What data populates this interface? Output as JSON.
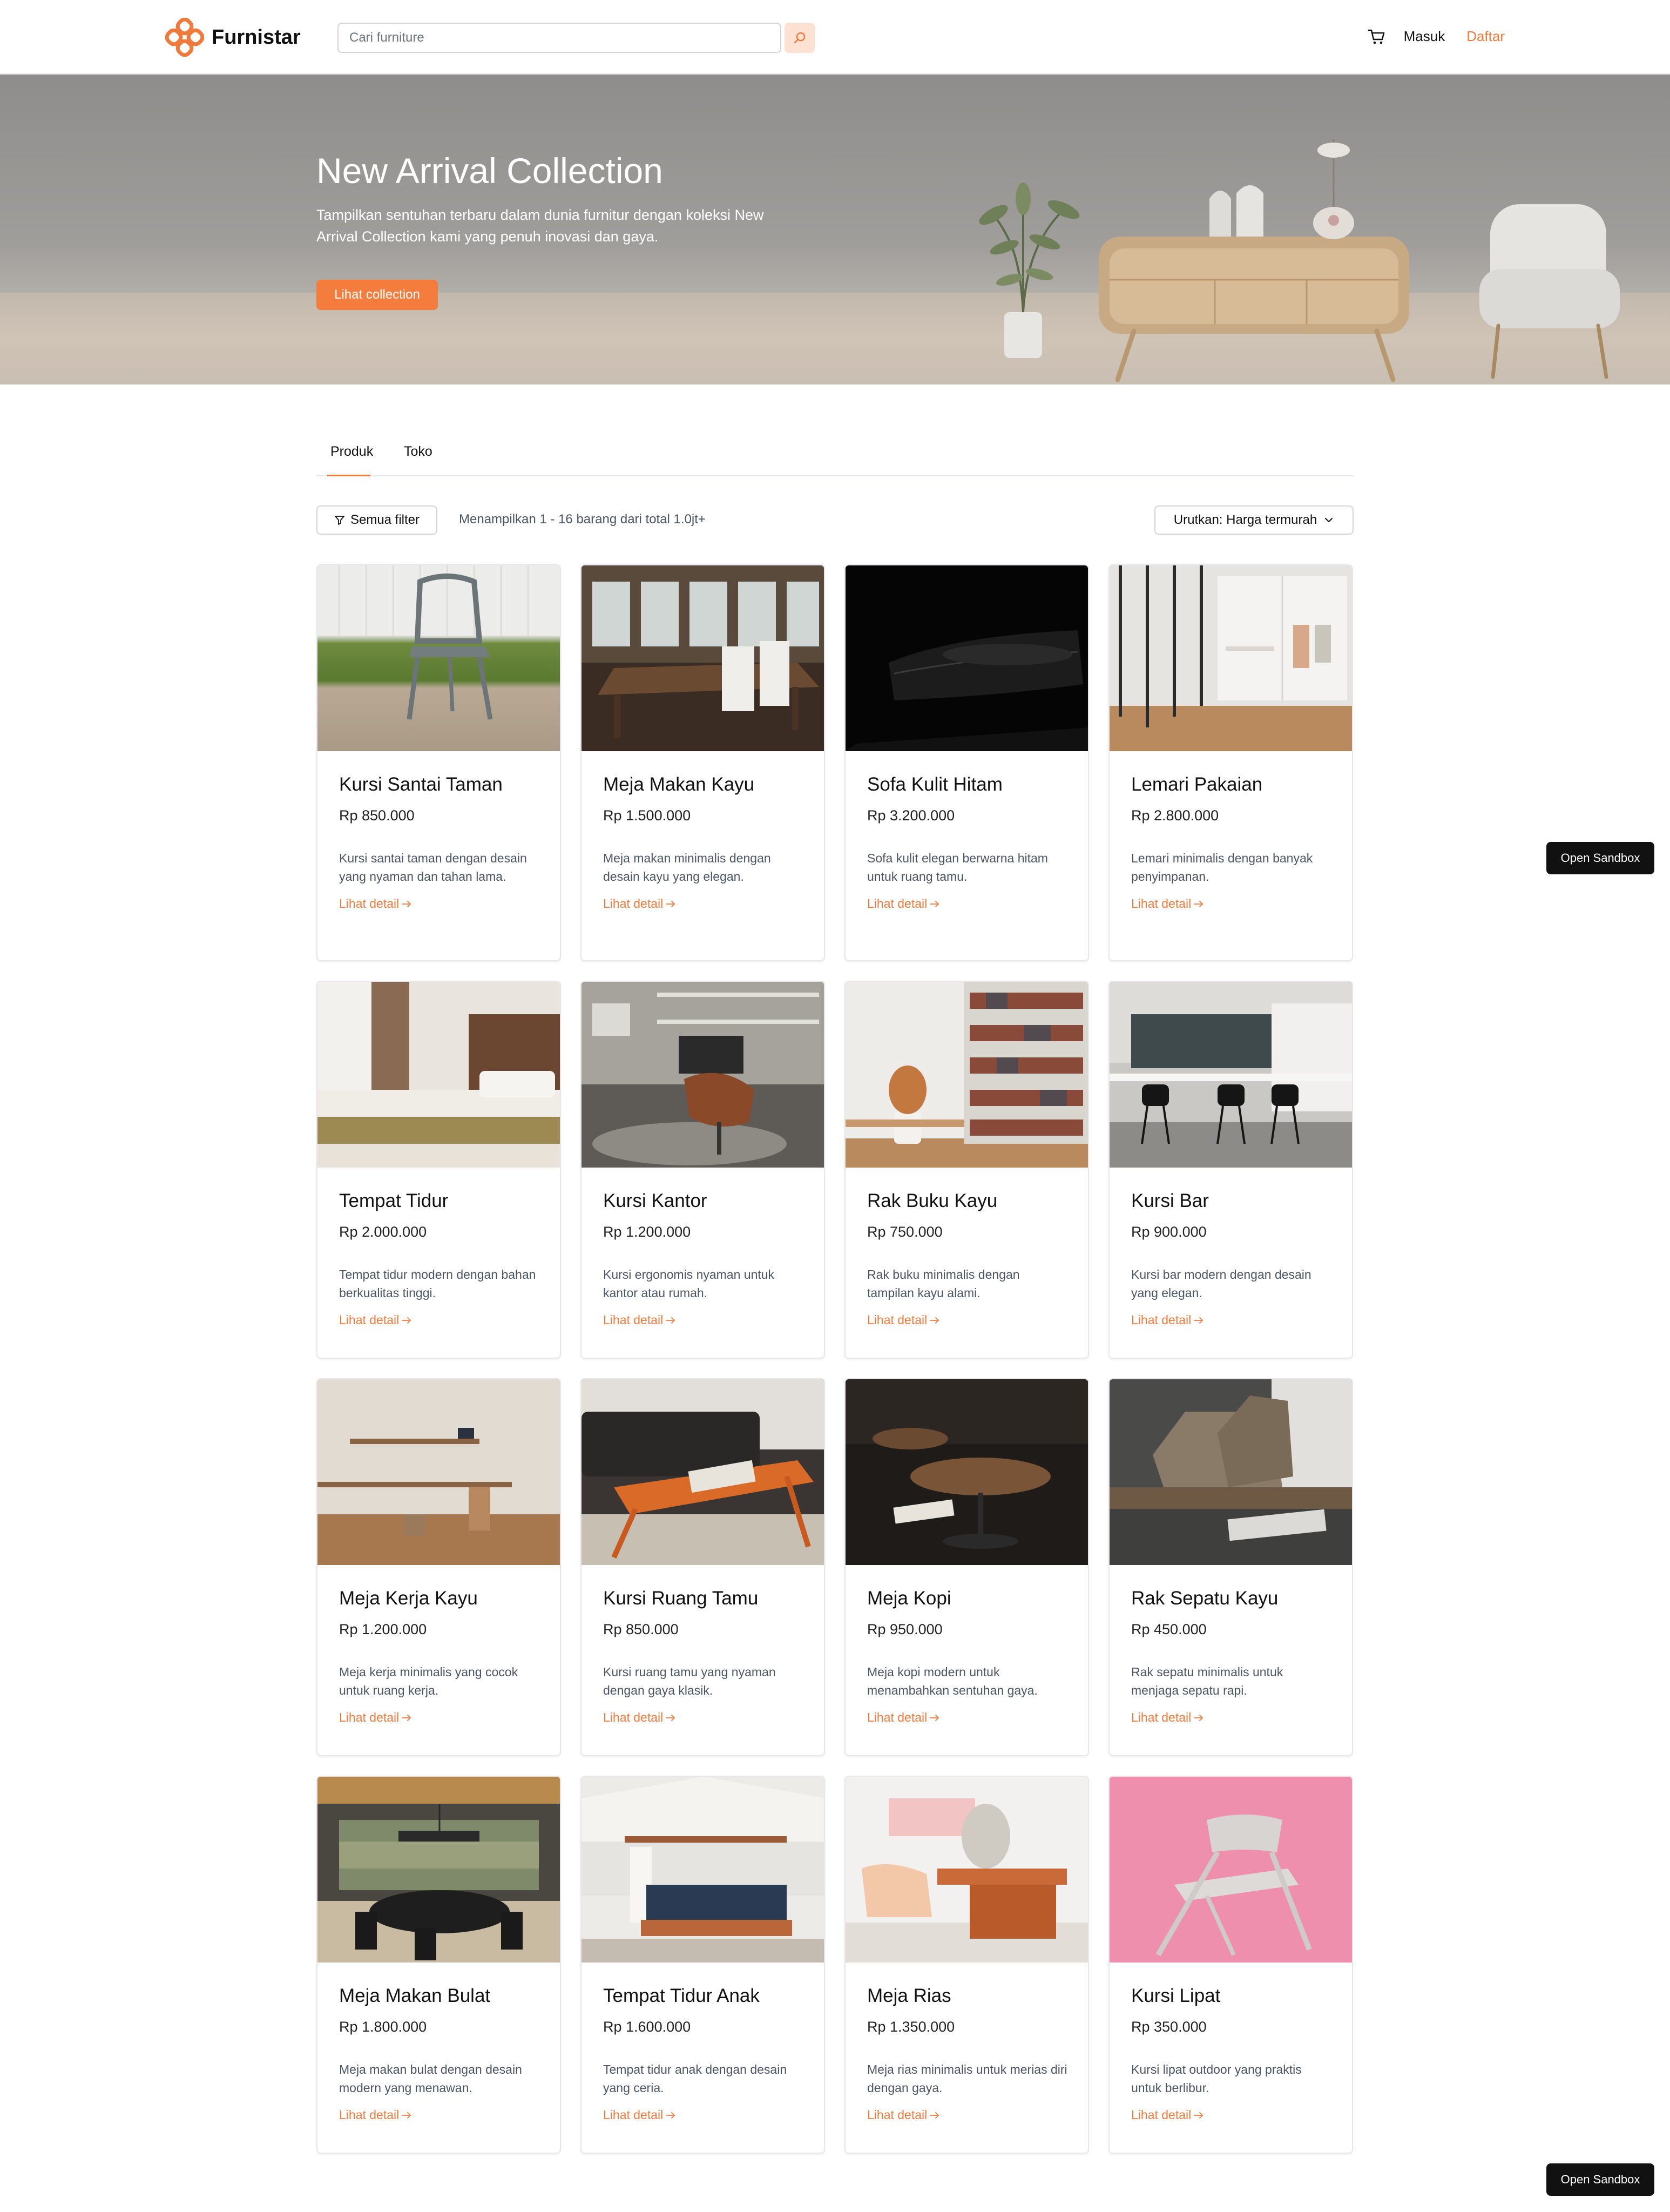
{
  "brand": {
    "name": "Furnistar",
    "accent": "#f07a3b"
  },
  "search": {
    "placeholder": "Cari furniture",
    "icon": "search-icon"
  },
  "nav": {
    "cart_icon": "cart-icon",
    "login": "Masuk",
    "register": "Daftar"
  },
  "hero": {
    "title": "New Arrival Collection",
    "subtitle": "Tampilkan sentuhan terbaru dalam dunia furnitur dengan koleksi New Arrival Collection kami yang penuh inovasi dan gaya.",
    "cta": "Lihat collection"
  },
  "tabs": [
    {
      "label": "Produk",
      "active": true
    },
    {
      "label": "Toko",
      "active": false
    }
  ],
  "toolbar": {
    "filter_label": "Semua filter",
    "filter_icon": "filter-icon",
    "results": "Menampilkan 1 - 16 barang dari total 1.0jt+",
    "sort_label": "Urutkan: Harga termurah",
    "sort_icon": "chevron-down-icon"
  },
  "products": [
    {
      "name": "Kursi Santai Taman",
      "price": "Rp 850.000",
      "desc": "Kursi santai taman dengan desain yang nyaman dan tahan lama.",
      "link": "Lihat detail"
    },
    {
      "name": "Meja Makan Kayu",
      "price": "Rp 1.500.000",
      "desc": "Meja makan minimalis dengan desain kayu yang elegan.",
      "link": "Lihat detail"
    },
    {
      "name": "Sofa Kulit Hitam",
      "price": "Rp 3.200.000",
      "desc": "Sofa kulit elegan berwarna hitam untuk ruang tamu.",
      "link": "Lihat detail"
    },
    {
      "name": "Lemari Pakaian",
      "price": "Rp 2.800.000",
      "desc": "Lemari minimalis dengan banyak penyimpanan.",
      "link": "Lihat detail"
    },
    {
      "name": "Tempat Tidur",
      "price": "Rp 2.000.000",
      "desc": "Tempat tidur modern dengan bahan berkualitas tinggi.",
      "link": "Lihat detail"
    },
    {
      "name": "Kursi Kantor",
      "price": "Rp 1.200.000",
      "desc": "Kursi ergonomis nyaman untuk kantor atau rumah.",
      "link": "Lihat detail"
    },
    {
      "name": "Rak Buku Kayu",
      "price": "Rp 750.000",
      "desc": "Rak buku minimalis dengan tampilan kayu alami.",
      "link": "Lihat detail"
    },
    {
      "name": "Kursi Bar",
      "price": "Rp 900.000",
      "desc": "Kursi bar modern dengan desain yang elegan.",
      "link": "Lihat detail"
    },
    {
      "name": "Meja Kerja Kayu",
      "price": "Rp 1.200.000",
      "desc": "Meja kerja minimalis yang cocok untuk ruang kerja.",
      "link": "Lihat detail"
    },
    {
      "name": "Kursi Ruang Tamu",
      "price": "Rp 850.000",
      "desc": "Kursi ruang tamu yang nyaman dengan gaya klasik.",
      "link": "Lihat detail"
    },
    {
      "name": "Meja Kopi",
      "price": "Rp 950.000",
      "desc": "Meja kopi modern untuk menambahkan sentuhan gaya.",
      "link": "Lihat detail"
    },
    {
      "name": "Rak Sepatu Kayu",
      "price": "Rp 450.000",
      "desc": "Rak sepatu minimalis untuk menjaga sepatu rapi.",
      "link": "Lihat detail"
    },
    {
      "name": "Meja Makan Bulat",
      "price": "Rp 1.800.000",
      "desc": "Meja makan bulat dengan desain modern yang menawan.",
      "link": "Lihat detail"
    },
    {
      "name": "Tempat Tidur Anak",
      "price": "Rp 1.600.000",
      "desc": "Tempat tidur anak dengan desain yang ceria.",
      "link": "Lihat detail"
    },
    {
      "name": "Meja Rias",
      "price": "Rp 1.350.000",
      "desc": "Meja rias minimalis untuk merias diri dengan gaya.",
      "link": "Lihat detail"
    },
    {
      "name": "Kursi Lipat",
      "price": "Rp 350.000",
      "desc": "Kursi lipat outdoor yang praktis untuk berlibur.",
      "link": "Lihat detail"
    }
  ],
  "sandbox": {
    "label": "Open Sandbox"
  }
}
